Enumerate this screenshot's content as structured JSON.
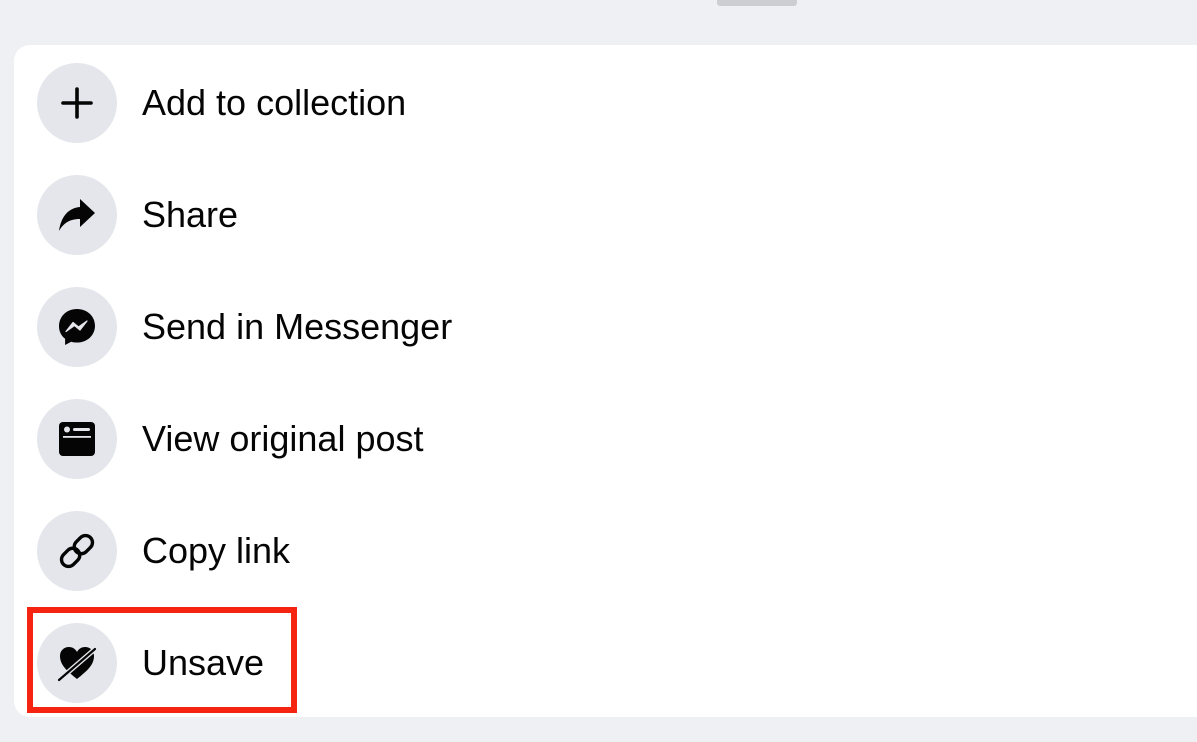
{
  "menu": {
    "items": [
      {
        "label": "Add to collection",
        "icon": "plus-icon"
      },
      {
        "label": "Share",
        "icon": "share-arrow-icon"
      },
      {
        "label": "Send in Messenger",
        "icon": "messenger-icon"
      },
      {
        "label": "View original post",
        "icon": "post-icon"
      },
      {
        "label": "Copy link",
        "icon": "link-icon"
      },
      {
        "label": "Unsave",
        "icon": "unsave-icon"
      }
    ]
  },
  "colors": {
    "background": "#eff0f4",
    "sheet": "#ffffff",
    "icon_circle": "#e4e6eb",
    "text": "#050505",
    "highlight": "#f5230f"
  }
}
